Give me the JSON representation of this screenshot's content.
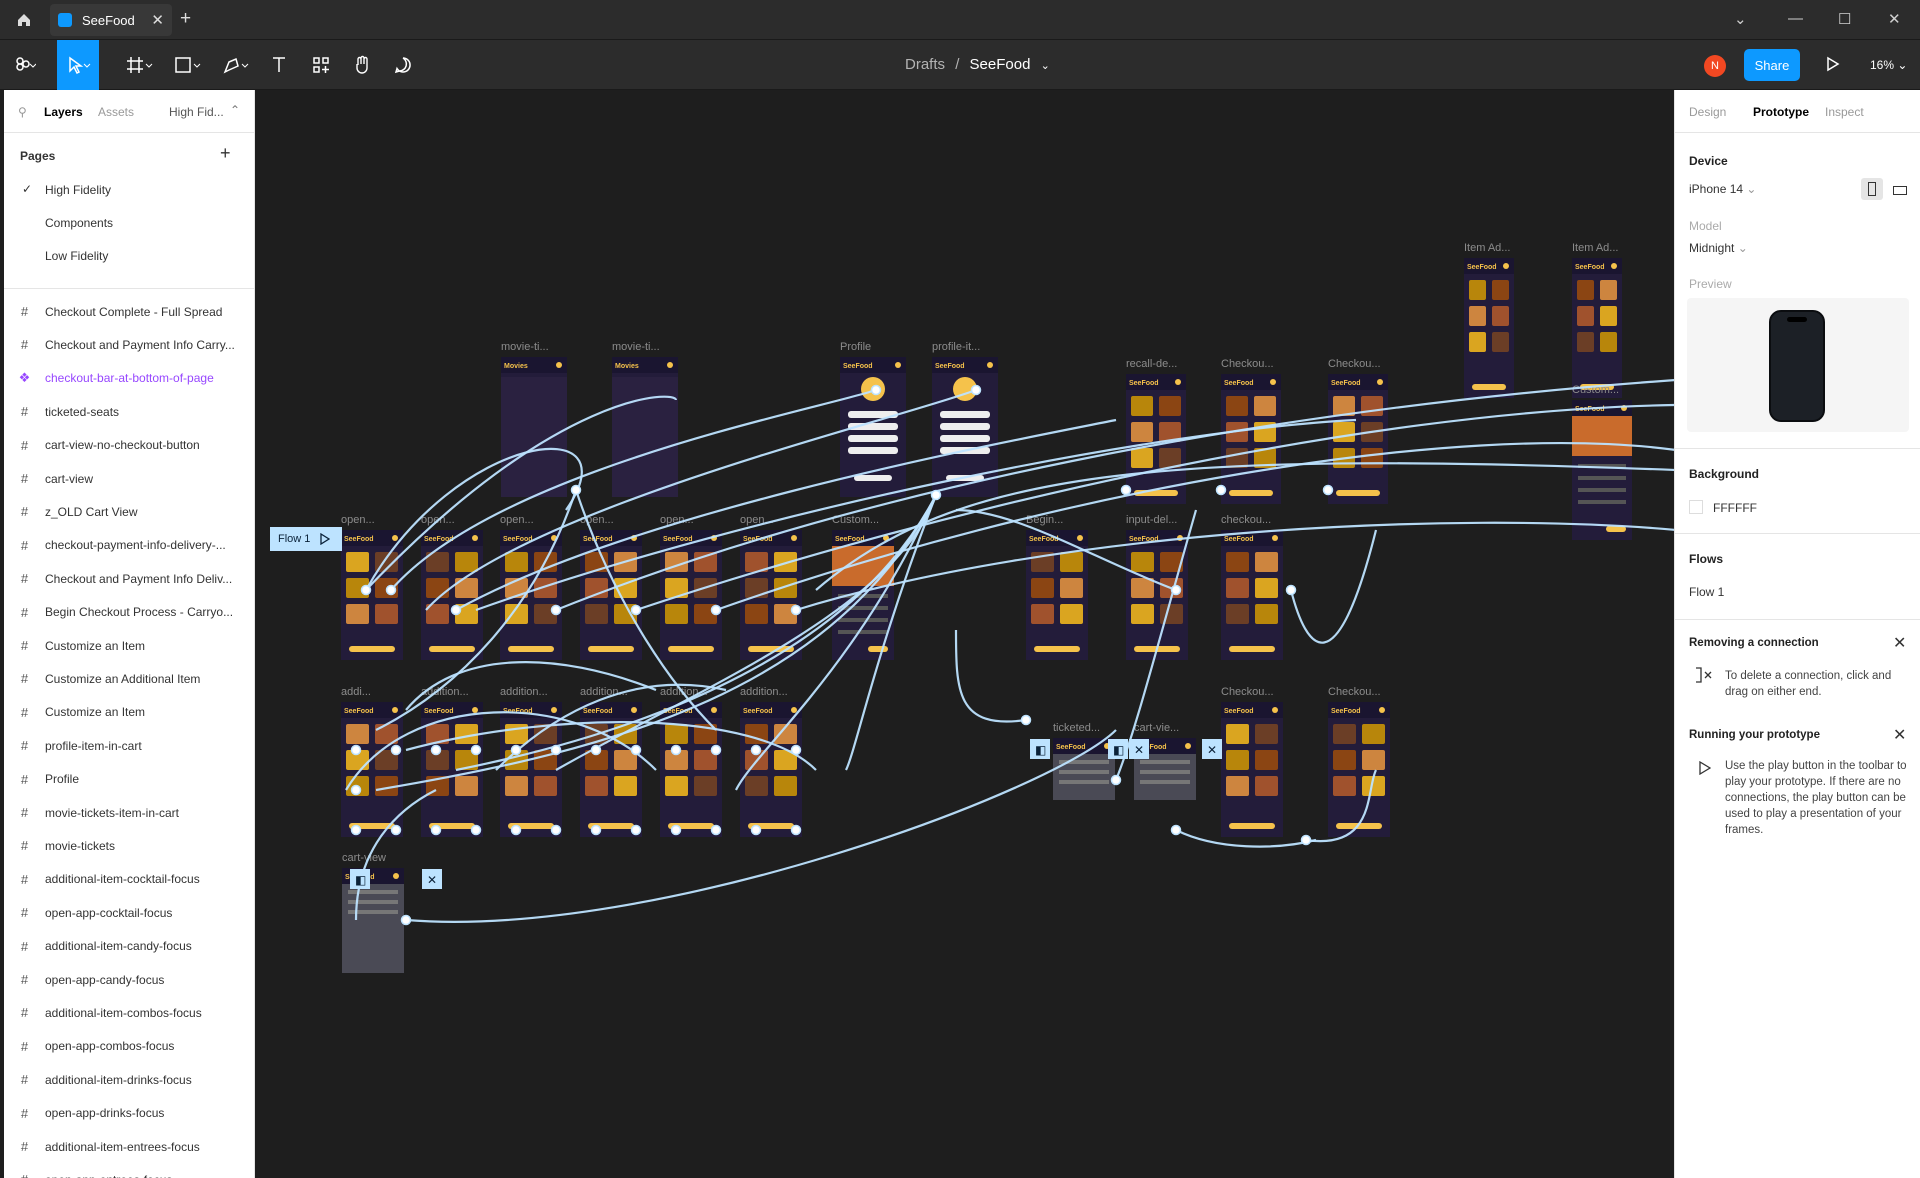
{
  "tabs": [
    {
      "label": "SeeFood"
    }
  ],
  "toolbar": {
    "breadcrumb_parent": "Drafts",
    "breadcrumb_sep": "/",
    "breadcrumb_current": "SeeFood",
    "avatar_initial": "N",
    "share_label": "Share",
    "zoom": "16%"
  },
  "left_panel": {
    "tab_layers": "Layers",
    "tab_assets": "Assets",
    "page_selector": "High Fid...",
    "pages_title": "Pages",
    "pages": [
      "High Fidelity",
      "Components",
      "Low Fidelity"
    ],
    "layers": [
      "Checkout Complete - Full Spread",
      "Checkout and Payment Info Carry...",
      "checkout-bar-at-bottom-of-page",
      "ticketed-seats",
      "cart-view-no-checkout-button",
      "cart-view",
      "z_OLD Cart View",
      "checkout-payment-info-delivery-...",
      "Checkout and Payment Info Deliv...",
      "Begin Checkout Process - Carryo...",
      "Customize an Item",
      "Customize an Additional Item",
      "Customize an Item",
      "profile-item-in-cart",
      "Profile",
      "movie-tickets-item-in-cart",
      "movie-tickets",
      "additional-item-cocktail-focus",
      "open-app-cocktail-focus",
      "additional-item-candy-focus",
      "open-app-candy-focus",
      "additional-item-combos-focus",
      "open-app-combos-focus",
      "additional-item-drinks-focus",
      "open-app-drinks-focus",
      "additional-item-entrees-focus",
      "open-app-entrees-focus"
    ]
  },
  "right_panel": {
    "tab_design": "Design",
    "tab_prototype": "Prototype",
    "tab_inspect": "Inspect",
    "device_title": "Device",
    "device_value": "iPhone 14",
    "model_label": "Model",
    "model_value": "Midnight",
    "preview_label": "Preview",
    "background_title": "Background",
    "background_value": "FFFFFF",
    "flows_title": "Flows",
    "flow_name": "Flow 1",
    "tip1_title": "Removing a connection",
    "tip1_text": "To delete a connection, click and drag on either end.",
    "tip2_title": "Running your prototype",
    "tip2_text": "Use the play button in the toolbar to play your prototype. If there are no connections, the play button can be used to play a presentation of your frames."
  },
  "canvas": {
    "flow_tag": "Flow 1",
    "frame_labels": [
      "Item Ad...",
      "Item Ad...",
      "movie-ti...",
      "movie-ti...",
      "Profile",
      "profile-it...",
      "recall-de...",
      "Checkou...",
      "Checkou...",
      "Custom...",
      "open...",
      "open...",
      "open...",
      "open...",
      "open...",
      "open...",
      "Custom...",
      "Begin...",
      "input-del...",
      "checkou...",
      "addi...",
      "addition...",
      "addition...",
      "addition...",
      "addition...",
      "addition...",
      "ticketed...",
      "cart-vie...",
      "Checkou...",
      "Checkou...",
      "cart-view"
    ],
    "screen_brand": "SeeFood",
    "screen_movies": "Movies"
  },
  "colors": {
    "accent": "#0d99ff",
    "connector": "#bde3ff",
    "canvas_bg": "#1e1e1e",
    "frame_bg": "#231c3a"
  }
}
